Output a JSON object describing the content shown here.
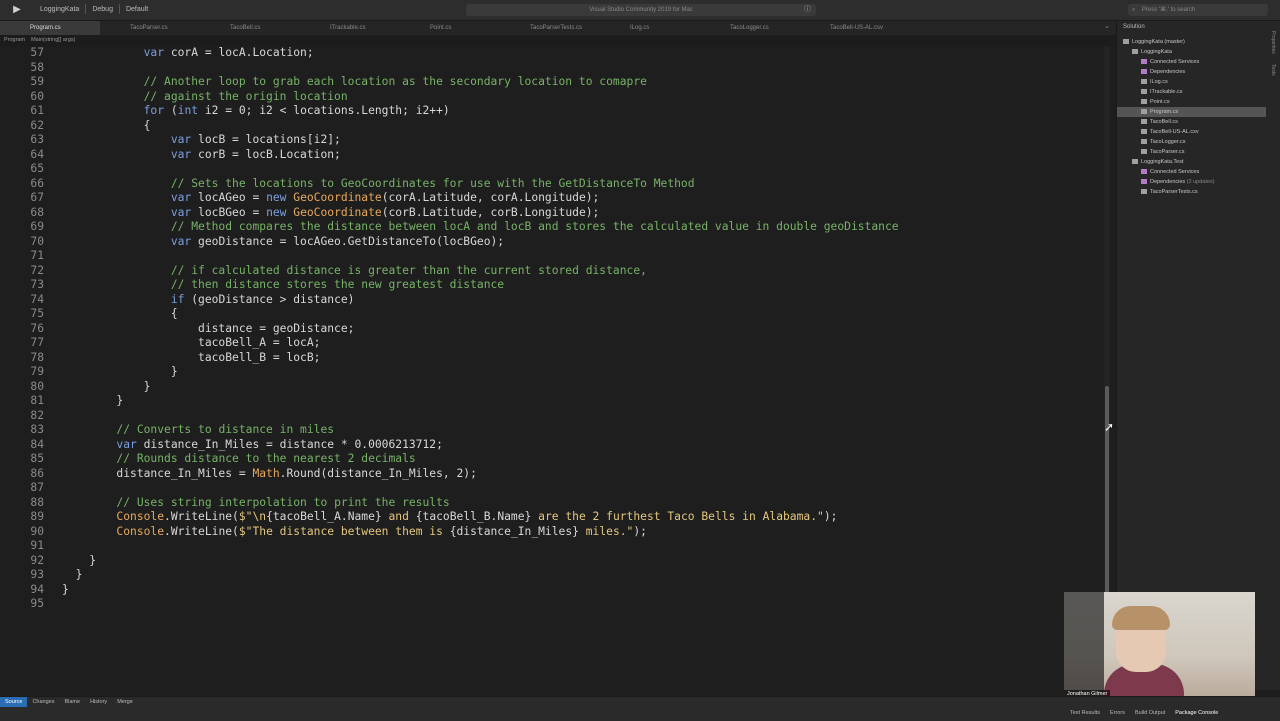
{
  "titlebar": {
    "project": "LoggingKata",
    "config": "Debug",
    "target": "Default",
    "status": "Visual Studio Community 2019 for Mac",
    "search_placeholder": "Press '⌘.' to search"
  },
  "tabs": [
    "Program.cs",
    "TacoParser.cs",
    "TacoBell.cs",
    "ITrackable.cs",
    "Point.cs",
    "TacoParserTests.cs",
    "ILog.cs",
    "TacoLogger.cs",
    "TacoBell-US-AL.csv"
  ],
  "active_tab": "Program.cs",
  "pathbar": {
    "class": "Program",
    "method": "Main(string[] args)"
  },
  "code_lines": [
    {
      "n": "57",
      "html": "            <span class=\"kw\">var</span> corA = locA.Location;"
    },
    {
      "n": "58",
      "html": ""
    },
    {
      "n": "59",
      "html": "            <span class=\"cm\">// Another loop to grab each location as the secondary location to comapre</span>"
    },
    {
      "n": "60",
      "html": "            <span class=\"cm\">// against the origin location</span>"
    },
    {
      "n": "61",
      "html": "            <span class=\"kw\">for</span> (<span class=\"kw\">int</span> i2 = 0; i2 &lt; locations.Length; i2++)"
    },
    {
      "n": "62",
      "html": "            {"
    },
    {
      "n": "63",
      "html": "                <span class=\"kw\">var</span> locB = locations[i2];"
    },
    {
      "n": "64",
      "html": "                <span class=\"kw\">var</span> corB = locB.Location;"
    },
    {
      "n": "65",
      "html": ""
    },
    {
      "n": "66",
      "html": "                <span class=\"cm\">// Sets the locations to GeoCoordinates for use with the GetDistanceTo Method</span>"
    },
    {
      "n": "67",
      "html": "                <span class=\"kw\">var</span> locAGeo = <span class=\"kw\">new</span> <span class=\"ty\">GeoCoordinate</span>(corA.Latitude, corA.Longitude);"
    },
    {
      "n": "68",
      "html": "                <span class=\"kw\">var</span> locBGeo = <span class=\"kw\">new</span> <span class=\"ty\">GeoCoordinate</span>(corB.Latitude, corB.Longitude);"
    },
    {
      "n": "69",
      "html": "                <span class=\"cm\">// Method compares the distance between locA and locB and stores the calculated value in double geoDistance</span>"
    },
    {
      "n": "70",
      "html": "                <span class=\"kw\">var</span> geoDistance = locAGeo.GetDistanceTo(locBGeo);"
    },
    {
      "n": "71",
      "html": ""
    },
    {
      "n": "72",
      "html": "                <span class=\"cm\">// if calculated distance is greater than the current stored distance,</span>"
    },
    {
      "n": "73",
      "html": "                <span class=\"cm\">// then distance stores the new greatest distance</span>"
    },
    {
      "n": "74",
      "html": "                <span class=\"kw\">if</span> (geoDistance &gt; distance)"
    },
    {
      "n": "75",
      "html": "                {"
    },
    {
      "n": "76",
      "html": "                    distance = geoDistance;"
    },
    {
      "n": "77",
      "html": "                    tacoBell_A = locA;"
    },
    {
      "n": "78",
      "html": "                    tacoBell_B = locB;"
    },
    {
      "n": "79",
      "html": "                }"
    },
    {
      "n": "80",
      "html": "            }"
    },
    {
      "n": "81",
      "html": "        }"
    },
    {
      "n": "82",
      "html": ""
    },
    {
      "n": "83",
      "html": "        <span class=\"cm\">// Converts to distance in miles</span>"
    },
    {
      "n": "84",
      "html": "        <span class=\"kw\">var</span> distance_In_Miles = distance * 0.0006213712;"
    },
    {
      "n": "85",
      "html": "        <span class=\"cm\">// Rounds distance to the nearest 2 decimals</span>"
    },
    {
      "n": "86",
      "html": "        distance_In_Miles = <span class=\"ty\">Math</span>.Round(distance_In_Miles, 2);"
    },
    {
      "n": "87",
      "html": ""
    },
    {
      "n": "88",
      "html": "        <span class=\"cm\">// Uses string interpolation to print the results</span>"
    },
    {
      "n": "89",
      "html": "        <span class=\"ty\">Console</span>.WriteLine(<span class=\"st\">$\"\\n</span>{tacoBell_A.Name}<span class=\"st\"> and </span>{tacoBell_B.Name}<span class=\"st\"> are the 2 furthest Taco Bells in Alabama.\"</span>);"
    },
    {
      "n": "90",
      "html": "        <span class=\"ty\">Console</span>.WriteLine(<span class=\"st\">$\"The distance between them is </span>{distance_In_Miles}<span class=\"st\"> miles.\"</span>);"
    },
    {
      "n": "91",
      "html": ""
    },
    {
      "n": "92",
      "html": "    }"
    },
    {
      "n": "93",
      "html": "  }"
    },
    {
      "n": "94",
      "html": "}"
    },
    {
      "n": "95",
      "html": ""
    }
  ],
  "solution": {
    "header": "Solution",
    "items": [
      {
        "label": "LoggingKata (master)",
        "depth": 0,
        "kind": "file"
      },
      {
        "label": "LoggingKata",
        "depth": 1,
        "kind": "file"
      },
      {
        "label": "Connected Services",
        "depth": 2,
        "kind": "folder"
      },
      {
        "label": "Dependencies",
        "depth": 2,
        "kind": "folder"
      },
      {
        "label": "ILog.cs",
        "depth": 2,
        "kind": "file"
      },
      {
        "label": "ITrackable.cs",
        "depth": 2,
        "kind": "file"
      },
      {
        "label": "Point.cs",
        "depth": 2,
        "kind": "file"
      },
      {
        "label": "Program.cs",
        "depth": 2,
        "kind": "file",
        "selected": true
      },
      {
        "label": "TacoBell.cs",
        "depth": 2,
        "kind": "file"
      },
      {
        "label": "TacoBell-US-AL.csv",
        "depth": 2,
        "kind": "file"
      },
      {
        "label": "TacoLogger.cs",
        "depth": 2,
        "kind": "file"
      },
      {
        "label": "TacoParser.cs",
        "depth": 2,
        "kind": "file"
      },
      {
        "label": "LoggingKata.Test",
        "depth": 1,
        "kind": "file"
      },
      {
        "label": "Connected Services",
        "depth": 2,
        "kind": "folder"
      },
      {
        "label": "Dependencies",
        "depth": 2,
        "kind": "folder",
        "note": "(2 updates)"
      },
      {
        "label": "TacoParserTests.cs",
        "depth": 2,
        "kind": "file"
      }
    ]
  },
  "right_strip": [
    "Properties",
    "Tests"
  ],
  "webcam": {
    "name": "Jonathan Gilmer"
  },
  "vcs_tabs": [
    "Source",
    "Changes",
    "Blame",
    "History",
    "Merge"
  ],
  "pads": [
    "Test Results",
    "Errors",
    "Build Output",
    "Package Console"
  ]
}
